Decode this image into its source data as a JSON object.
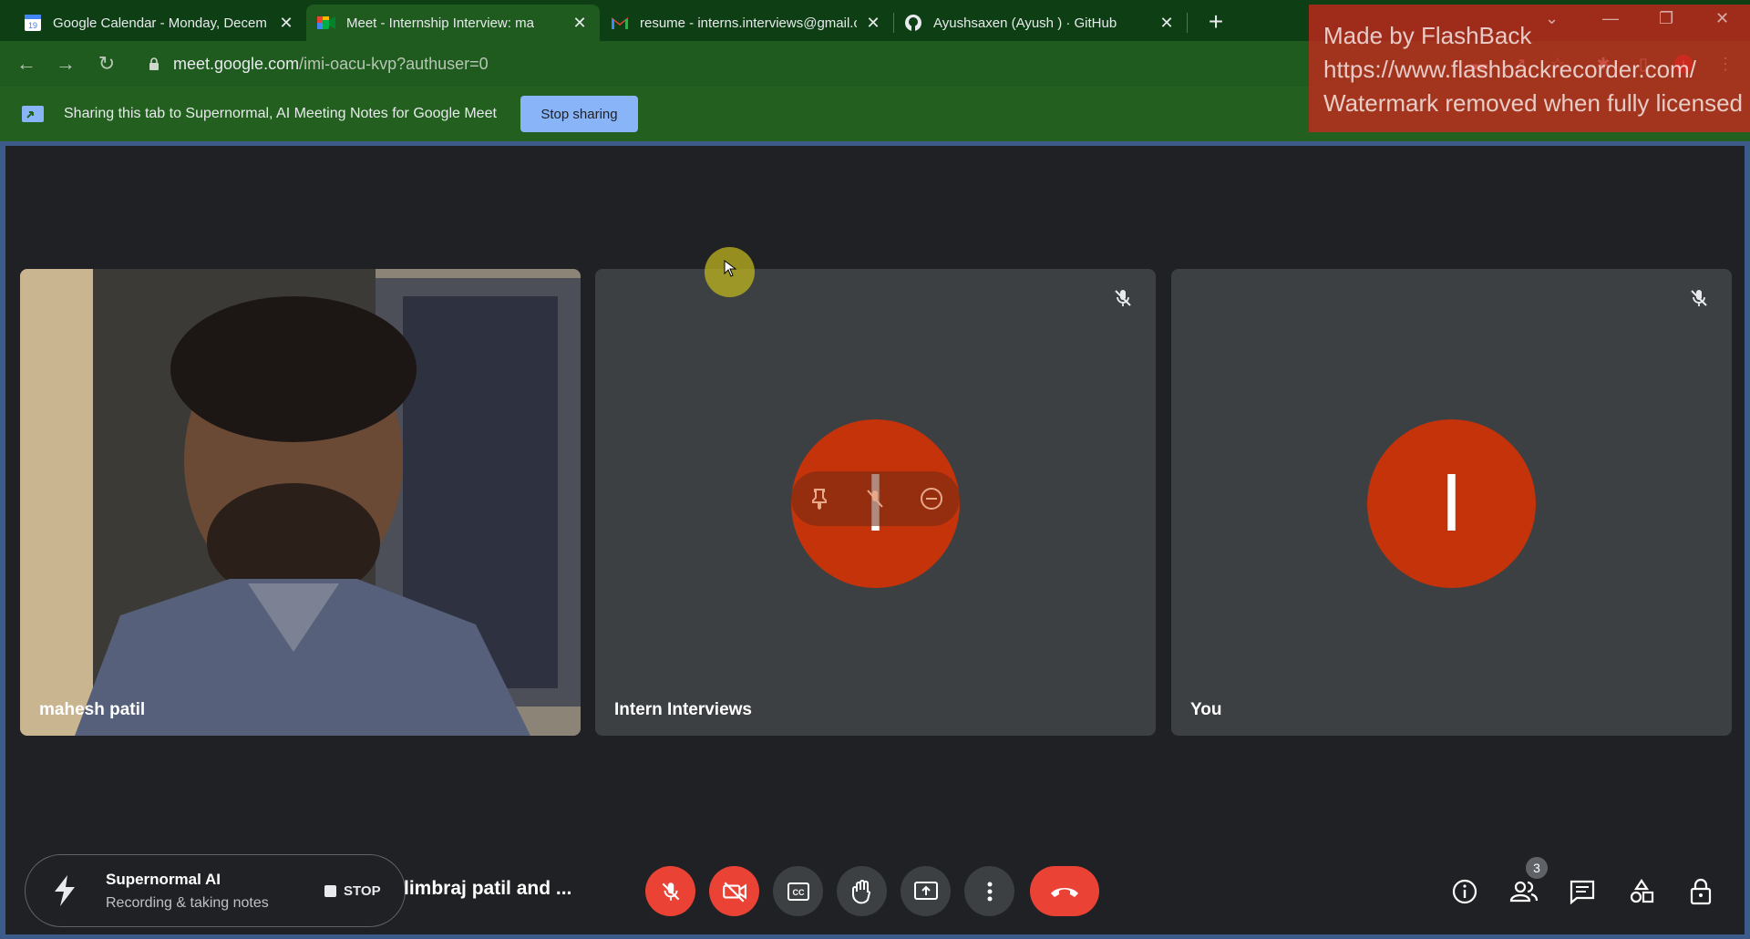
{
  "browser": {
    "tabs": [
      {
        "title": "Google Calendar - Monday, Decem",
        "favicon": "calendar-icon",
        "favicon_label": "19"
      },
      {
        "title": "Meet - Internship Interview: ma",
        "favicon": "meet-icon"
      },
      {
        "title": "resume - interns.interviews@gmail.c",
        "favicon": "gmail-icon"
      },
      {
        "title": "Ayushsaxen (Ayush ) · GitHub",
        "favicon": "github-icon"
      }
    ],
    "url_host": "meet.google.com",
    "url_path": "/imi-oacu-kvp?authuser=0"
  },
  "share_bar": {
    "text": "Sharing this tab to Supernormal, AI Meeting Notes for Google Meet",
    "button": "Stop sharing"
  },
  "watermark": {
    "line1": "Made by FlashBack",
    "line2": "https://www.flashbackrecorder.com/",
    "line3": "Watermark removed when fully licensed"
  },
  "participants": [
    {
      "name": "mahesh patil",
      "has_video": true
    },
    {
      "name": "Intern Interviews",
      "avatar_letter": "I",
      "muted": true
    },
    {
      "name": "You",
      "avatar_letter": "I",
      "muted": true
    }
  ],
  "supernormal": {
    "title": "Supernormal AI",
    "subtitle": "Recording & taking notes",
    "stop": "STOP"
  },
  "meeting_title": "limbraj patil and ...",
  "people_count": "3",
  "colors": {
    "avatar": "#c5330a",
    "hangup": "#ea4335",
    "chrome_green": "#1f5a1e"
  }
}
